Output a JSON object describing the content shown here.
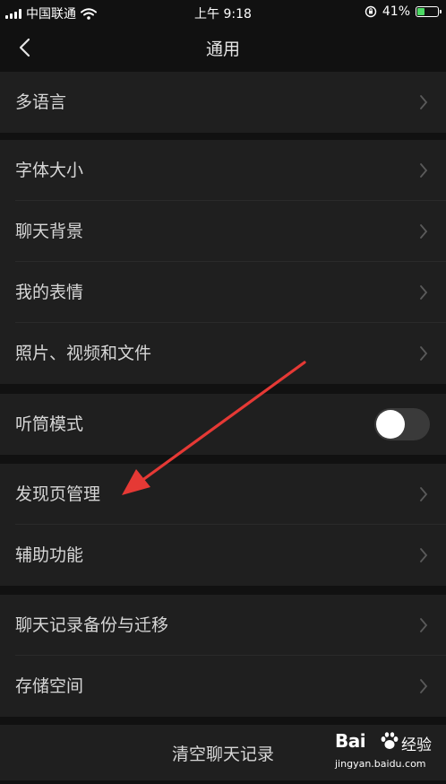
{
  "status_bar": {
    "carrier": "中国联通",
    "time": "上午 9:18",
    "battery_percent": "41%",
    "battery_level": 0.41
  },
  "nav": {
    "title": "通用",
    "back_icon": "chevron-left-icon"
  },
  "groups": [
    {
      "items": [
        {
          "label": "多语言"
        }
      ]
    },
    {
      "items": [
        {
          "label": "字体大小"
        },
        {
          "label": "聊天背景"
        },
        {
          "label": "我的表情"
        },
        {
          "label": "照片、视频和文件"
        }
      ]
    },
    {
      "items": [
        {
          "label": "听筒模式",
          "toggle": false
        }
      ]
    },
    {
      "items": [
        {
          "label": "发现页管理"
        },
        {
          "label": "辅助功能"
        }
      ]
    },
    {
      "items": [
        {
          "label": "聊天记录备份与迁移"
        },
        {
          "label": "存储空间"
        }
      ]
    }
  ],
  "clear_button": {
    "label": "清空聊天记录"
  },
  "annotation": {
    "color": "#e53935"
  },
  "watermark": {
    "brand": "Bai",
    "suffix": "经验",
    "url": "jingyan.baidu.com"
  },
  "colors": {
    "background": "#111111",
    "cell": "#1f1f1f",
    "toggle_off": "#3a3a3a"
  }
}
